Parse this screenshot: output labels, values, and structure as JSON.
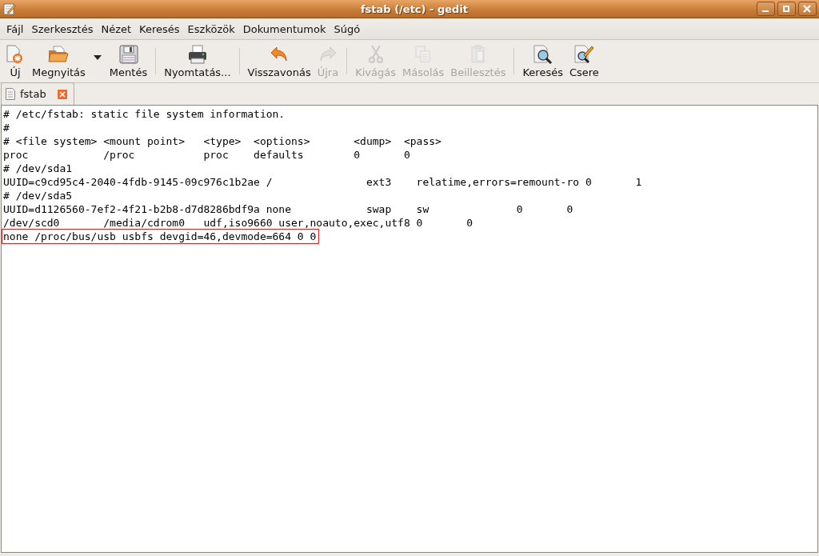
{
  "window": {
    "title": "fstab (/etc) - gedit"
  },
  "menu": [
    "Fájl",
    "Szerkesztés",
    "Nézet",
    "Keresés",
    "Eszközök",
    "Dokumentumok",
    "Súgó"
  ],
  "toolbar": [
    {
      "kind": "button",
      "label": "Új",
      "disabled": false
    },
    {
      "kind": "button",
      "label": "Megnyitás",
      "disabled": false
    },
    {
      "kind": "dropdown"
    },
    {
      "kind": "button",
      "label": "Mentés",
      "disabled": false
    },
    {
      "kind": "separator"
    },
    {
      "kind": "button",
      "label": "Nyomtatás...",
      "disabled": false
    },
    {
      "kind": "separator"
    },
    {
      "kind": "button",
      "label": "Visszavonás",
      "disabled": false
    },
    {
      "kind": "button",
      "label": "Újra",
      "disabled": true
    },
    {
      "kind": "separator"
    },
    {
      "kind": "button",
      "label": "Kivágás",
      "disabled": true
    },
    {
      "kind": "button",
      "label": "Másolás",
      "disabled": true
    },
    {
      "kind": "button",
      "label": "Beillesztés",
      "disabled": true
    },
    {
      "kind": "separator"
    },
    {
      "kind": "button",
      "label": "Keresés",
      "disabled": false
    },
    {
      "kind": "button",
      "label": "Csere",
      "disabled": false
    }
  ],
  "tabs": [
    {
      "label": "fstab",
      "selected": true
    }
  ],
  "editor": {
    "lines": [
      {
        "text": "# /etc/fstab: static file system information.",
        "highlighted": false
      },
      {
        "text": "#",
        "highlighted": false
      },
      {
        "text": "# <file system> <mount point>   <type>  <options>       <dump>  <pass>",
        "highlighted": false
      },
      {
        "text": "proc            /proc           proc    defaults        0       0",
        "highlighted": false
      },
      {
        "text": "# /dev/sda1",
        "highlighted": false
      },
      {
        "text": "UUID=c9cd95c4-2040-4fdb-9145-09c976c1b2ae /               ext3    relatime,errors=remount-ro 0       1",
        "highlighted": false
      },
      {
        "text": "# /dev/sda5",
        "highlighted": false
      },
      {
        "text": "UUID=d1126560-7ef2-4f21-b2b8-d7d8286bdf9a none            swap    sw              0       0",
        "highlighted": false
      },
      {
        "text": "/dev/scd0       /media/cdrom0   udf,iso9660 user,noauto,exec,utf8 0       0",
        "highlighted": false
      },
      {
        "text": "none /proc/bus/usb usbfs devgid=46,devmode=664 0 0",
        "highlighted": true
      }
    ]
  }
}
